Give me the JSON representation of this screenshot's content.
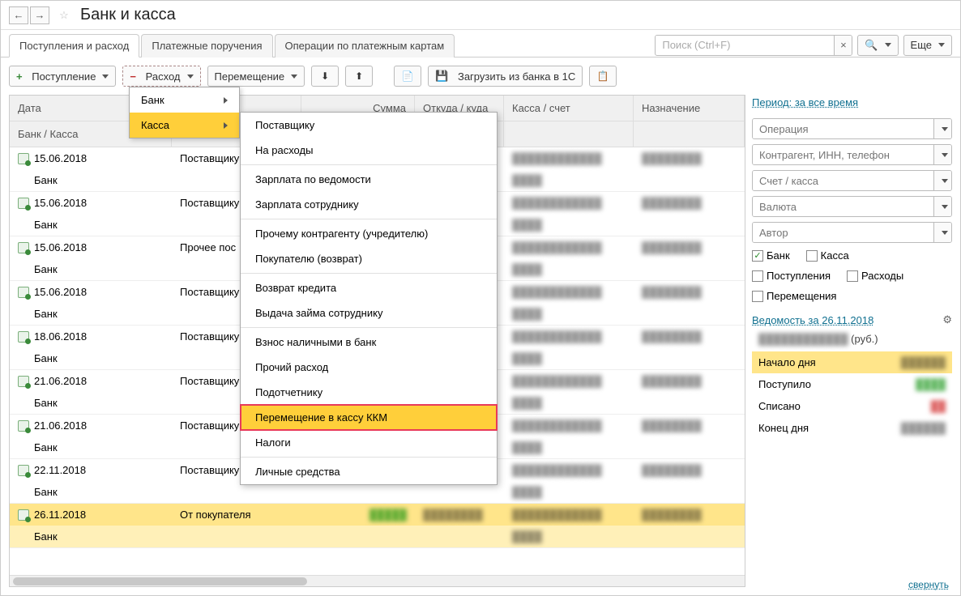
{
  "title": "Банк и касса",
  "tabs": [
    "Поступления и расход",
    "Платежные поручения",
    "Операции по платежным картам"
  ],
  "search_placeholder": "Поиск (Ctrl+F)",
  "more_label": "Еще",
  "toolbar": {
    "income": "Поступление",
    "expense": "Расход",
    "move": "Перемещение",
    "load_bank": "Загрузить из банка в 1С"
  },
  "columns": {
    "date": "Дата",
    "bank": "Банк / Касса",
    "sum": "Сумма",
    "where": "Откуда / куда",
    "acc": "Касса / счет",
    "purpose": "Назначение"
  },
  "rows": [
    {
      "date": "15.06.2018",
      "op": "Поставщику",
      "bank": "Банк",
      "selected": false
    },
    {
      "date": "15.06.2018",
      "op": "Поставщику",
      "bank": "Банк",
      "selected": false
    },
    {
      "date": "15.06.2018",
      "op": "Прочее пос",
      "bank": "Банк",
      "selected": false
    },
    {
      "date": "15.06.2018",
      "op": "Поставщику",
      "bank": "Банк",
      "selected": false
    },
    {
      "date": "18.06.2018",
      "op": "Поставщику",
      "bank": "Банк",
      "selected": false
    },
    {
      "date": "21.06.2018",
      "op": "Поставщику",
      "bank": "Банк",
      "selected": false
    },
    {
      "date": "21.06.2018",
      "op": "Поставщику",
      "bank": "Банк",
      "selected": false
    },
    {
      "date": "22.11.2018",
      "op": "Поставщику",
      "bank": "Банк",
      "selected": false
    },
    {
      "date": "26.11.2018",
      "op": "От покупателя",
      "bank": "Банк",
      "selected": true
    }
  ],
  "submenu1": {
    "bank": "Банк",
    "kassa": "Касса"
  },
  "submenu2": [
    "Поставщику",
    "На расходы",
    "---",
    "Зарплата по ведомости",
    "Зарплата сотруднику",
    "---",
    "Прочему контрагенту (учредителю)",
    "Покупателю (возврат)",
    "---",
    "Возврат кредита",
    "Выдача займа сотруднику",
    "---",
    "Взнос наличными в банк",
    "Прочий расход",
    "Подотчетнику",
    "Перемещение в кассу ККМ",
    "Налоги",
    "---",
    "Личные средства"
  ],
  "submenu2_highlight": "Перемещение в кассу ККМ",
  "sidebar": {
    "period": "Период: за все время",
    "filters": {
      "operation": "Операция",
      "counterparty": "Контрагент, ИНН, телефон",
      "account": "Счет / касса",
      "currency": "Валюта",
      "author": "Автор"
    },
    "checks": {
      "bank": "Банк",
      "kassa": "Касса",
      "income": "Поступления",
      "expense": "Расходы",
      "move": "Перемещения"
    },
    "vedomost_title": "Ведомость за 26.11.2018",
    "vedomost_currency": "(руб.)",
    "vedomost": {
      "start": "Начало дня",
      "in": "Поступило",
      "out": "Списано",
      "end": "Конец дня"
    },
    "collapse": "свернуть"
  }
}
